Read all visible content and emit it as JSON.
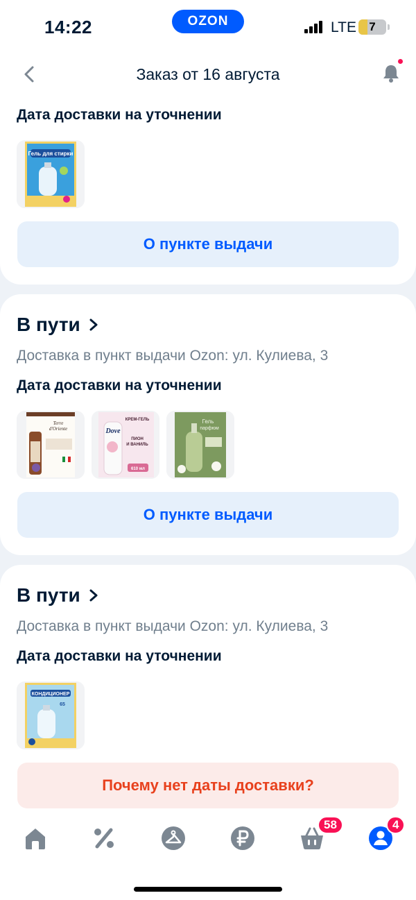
{
  "status_bar": {
    "time": "14:22",
    "brand": "OZON",
    "network": "LTE",
    "battery": "7"
  },
  "header": {
    "title": "Заказ от 16 августа",
    "back_icon": "chevron-left-icon",
    "bell_icon": "bell-icon"
  },
  "shipments": [
    {
      "date_label": "Дата доставки на уточнении",
      "products": [
        {
          "name": "Гель для стирки",
          "icon": "product-thumbnail"
        }
      ],
      "button": "О пункте выдачи"
    },
    {
      "status": "В пути",
      "address": "Доставка в пункт выдачи Ozon: ул. Кулиева, 3",
      "date_label": "Дата доставки на уточнении",
      "products": [
        {
          "name": "Terre d'Oriente",
          "icon": "product-thumbnail"
        },
        {
          "name": "Dove",
          "icon": "product-thumbnail"
        },
        {
          "name": "Гель парфюм",
          "icon": "product-thumbnail"
        }
      ],
      "button": "О пункте выдачи"
    },
    {
      "status": "В пути",
      "address": "Доставка в пункт выдачи Ozon: ул. Кулиева, 3",
      "date_label": "Дата доставки на уточнении",
      "products": [
        {
          "name": "КОНДИЦИОНЕР",
          "icon": "product-thumbnail"
        }
      ],
      "button": "Почему нет даты доставки?"
    }
  ],
  "tabbar": {
    "tabs": [
      {
        "name": "home",
        "icon": "home-icon"
      },
      {
        "name": "discounts",
        "icon": "percent-icon"
      },
      {
        "name": "fresh",
        "icon": "hanger-icon"
      },
      {
        "name": "finance",
        "icon": "ruble-icon"
      },
      {
        "name": "cart",
        "icon": "basket-icon",
        "badge": "58"
      },
      {
        "name": "profile",
        "icon": "profile-icon",
        "badge": "4"
      }
    ]
  },
  "colors": {
    "accent": "#005bff",
    "badge": "#f91155",
    "warning": "#e8411d"
  }
}
